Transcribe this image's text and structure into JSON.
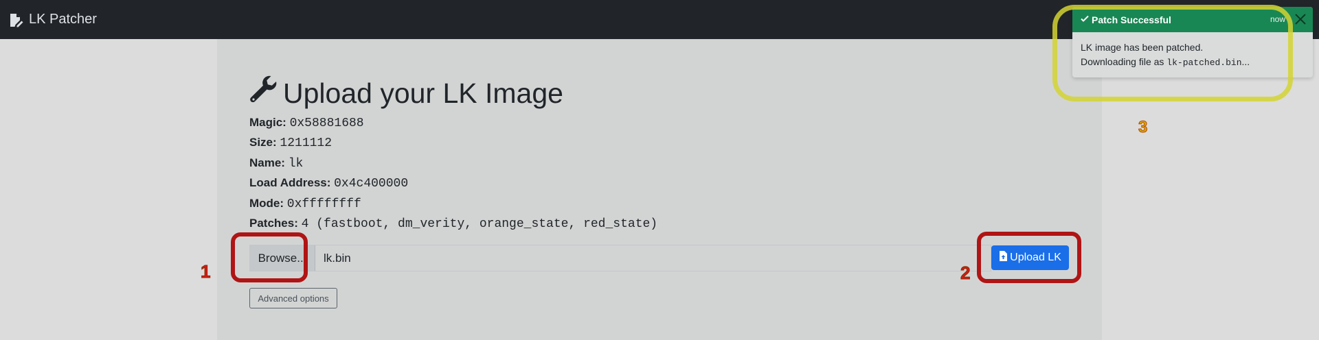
{
  "navbar": {
    "brand": "LK Patcher",
    "icon": "file-pen-icon"
  },
  "heading": {
    "icon": "wrench-icon",
    "title": "Upload your LK Image"
  },
  "info": [
    {
      "key": "Magic:",
      "value": "0x58881688"
    },
    {
      "key": "Size:",
      "value": "1211112"
    },
    {
      "key": "Name:",
      "value": "lk"
    },
    {
      "key": "Load Address:",
      "value": "0x4c400000"
    },
    {
      "key": "Mode:",
      "value": "0xffffffff"
    },
    {
      "key": "Patches:",
      "value": "4 (fastboot, dm_verity, orange_state, red_state)"
    }
  ],
  "file_input": {
    "browse_label": "Browse...",
    "filename": "lk.bin"
  },
  "upload_button": {
    "label": "Upload LK",
    "icon": "file-upload-icon",
    "color": "#1a6ee8"
  },
  "advanced_button": {
    "label": "Advanced options"
  },
  "annotations": {
    "one": "1",
    "two": "2",
    "three": "3"
  },
  "toast": {
    "title": "Patch Successful",
    "time": "now",
    "line1": "LK image has been patched.",
    "line2_prefix": "Downloading file as ",
    "line2_code": "lk-patched.bin",
    "line2_suffix": "...",
    "color": "#198754"
  }
}
